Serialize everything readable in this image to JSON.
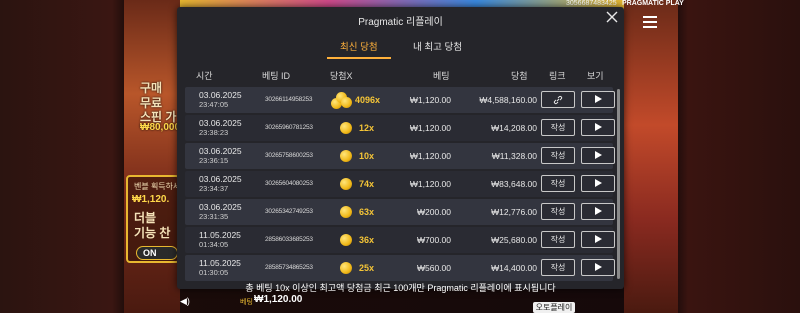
{
  "background": {
    "left_texts": [
      "구매",
      "무료",
      "스핀 가",
      "₩80,000"
    ],
    "buy_label": "벤블 획득하세",
    "buy_amount": "₩1,120.",
    "buy_texts": [
      "더블",
      "기능 찬"
    ],
    "toggle_label": "ON",
    "top_right_id": "3056687483425",
    "brand": "PRAGMATIC PLAY",
    "bet_label": "베팅",
    "bet_value": "₩1,120.00",
    "autoplay_label": "오토플레이"
  },
  "modal": {
    "title": "Pragmatic 리플레이",
    "tabs": [
      {
        "label": "최신 당첨",
        "active": true
      },
      {
        "label": "내 최고 당첨",
        "active": false
      }
    ],
    "columns": {
      "time": "시간",
      "bet_id": "베팅 ID",
      "win_x": "당첨X",
      "bet": "베팅",
      "win": "당첨",
      "link": "링크",
      "view": "보기"
    },
    "rows": [
      {
        "date": "03.06.2025",
        "time": "23:47:05",
        "bet_id": "30266114958253",
        "multiplier": "4096x",
        "big_coins": true,
        "bet": "₩1,120.00",
        "win": "₩4,588,160.00",
        "link": "link-icon"
      },
      {
        "date": "03.06.2025",
        "time": "23:38:23",
        "bet_id": "30265960781253",
        "multiplier": "12x",
        "big_coins": false,
        "bet": "₩1,120.00",
        "win": "₩14,208.00",
        "link": "작성"
      },
      {
        "date": "03.06.2025",
        "time": "23:36:15",
        "bet_id": "30265758600253",
        "multiplier": "10x",
        "big_coins": false,
        "bet": "₩1,120.00",
        "win": "₩11,328.00",
        "link": "작성"
      },
      {
        "date": "03.06.2025",
        "time": "23:34:37",
        "bet_id": "30265604080253",
        "multiplier": "74x",
        "big_coins": false,
        "bet": "₩1,120.00",
        "win": "₩83,648.00",
        "link": "작성"
      },
      {
        "date": "03.06.2025",
        "time": "23:31:35",
        "bet_id": "30265342749253",
        "multiplier": "63x",
        "big_coins": false,
        "bet": "₩200.00",
        "win": "₩12,776.00",
        "link": "작성"
      },
      {
        "date": "11.05.2025",
        "time": "01:34:05",
        "bet_id": "28586033685253",
        "multiplier": "36x",
        "big_coins": false,
        "bet": "₩700.00",
        "win": "₩25,680.00",
        "link": "작성"
      },
      {
        "date": "11.05.2025",
        "time": "01:30:05",
        "bet_id": "28585734865253",
        "multiplier": "25x",
        "big_coins": false,
        "bet": "₩560.00",
        "win": "₩14,400.00",
        "link": "작성"
      }
    ],
    "footer_note": "총 베팅 10x 이상인 최고액 당첨금 최근 100개만 Pragmatic 리플레이에 표시됩니다"
  },
  "colors": {
    "accent": "#ffb13b",
    "multiplier": "#f5c537",
    "modal_bg": "#25252a",
    "row_odd": "#33353f",
    "row_even": "#2a2b33"
  }
}
